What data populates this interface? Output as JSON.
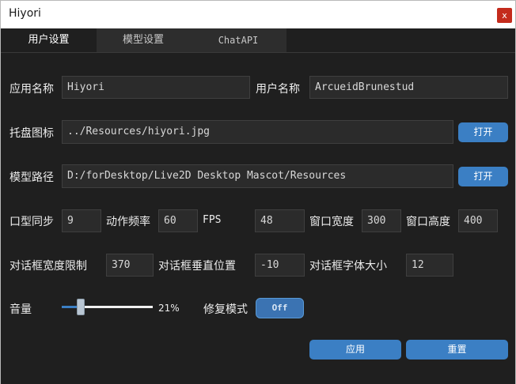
{
  "window": {
    "title": "Hiyori",
    "close_label": "x"
  },
  "tabs": [
    {
      "label": "用户设置",
      "active": true
    },
    {
      "label": "模型设置",
      "active": false
    },
    {
      "label": "ChatAPI",
      "active": false
    }
  ],
  "form": {
    "app_name": {
      "label": "应用名称",
      "value": "Hiyori"
    },
    "user_name": {
      "label": "用户名称",
      "value": "ArcueidBrunestud"
    },
    "tray_icon": {
      "label": "托盘图标",
      "value": "../Resources/hiyori.jpg",
      "button": "打开"
    },
    "model_path": {
      "label": "模型路径",
      "value": "D:/forDesktop/Live2D Desktop Mascot/Resources",
      "button": "打开"
    },
    "lip_sync": {
      "label": "口型同步",
      "value": "9"
    },
    "motion_freq": {
      "label": "动作频率",
      "value": "60"
    },
    "fps": {
      "label": "FPS",
      "value": "48"
    },
    "win_width": {
      "label": "窗口宽度",
      "value": "300"
    },
    "win_height": {
      "label": "窗口高度",
      "value": "400"
    },
    "dlg_width": {
      "label": "对话框宽度限制",
      "value": "370"
    },
    "dlg_vpos": {
      "label": "对话框垂直位置",
      "value": "-10"
    },
    "dlg_font": {
      "label": "对话框字体大小",
      "value": "12"
    },
    "volume": {
      "label": "音量",
      "value_text": "21%",
      "fraction": 0.21
    },
    "repair_mode": {
      "label": "修复模式",
      "toggle": "Off"
    }
  },
  "actions": {
    "apply": "应用",
    "reset": "重置"
  },
  "colors": {
    "accent": "#3b7fc4",
    "background": "#1f1f1f",
    "close": "#c42b1c"
  }
}
